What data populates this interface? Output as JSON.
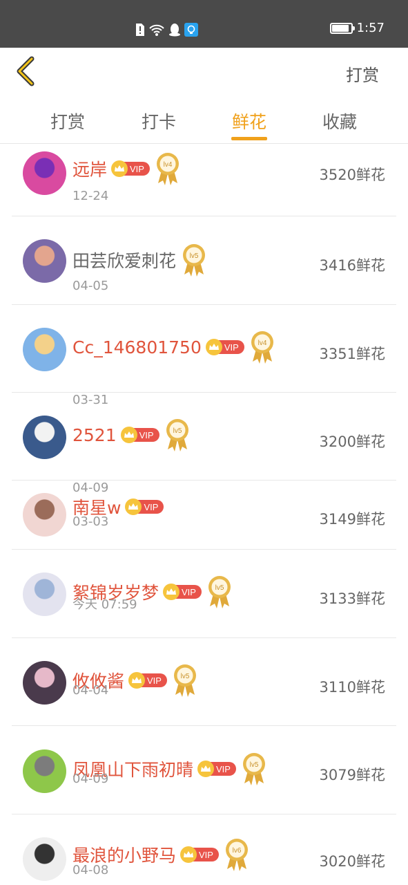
{
  "status_bar": {
    "time": "1:57",
    "battery_level": 0.85
  },
  "header": {
    "back_icon": "chevron-left-icon",
    "action_label": "打赏"
  },
  "tabs": [
    {
      "label": "打赏",
      "active": false
    },
    {
      "label": "打卡",
      "active": false
    },
    {
      "label": "鲜花",
      "active": true
    },
    {
      "label": "收藏",
      "active": false
    }
  ],
  "vip_label": "VIP",
  "rows": [
    {
      "name": "远岸",
      "vip": true,
      "level": "lv4",
      "date": "12-24",
      "count": "3520鲜花"
    },
    {
      "name": "田芸欣爱刺花",
      "vip": false,
      "level": "lv5",
      "date": "04-05",
      "count": "3416鲜花"
    },
    {
      "name": "Cc_146801750",
      "vip": true,
      "level": "lv4",
      "date": "03-31",
      "count": "3351鲜花"
    },
    {
      "name": "2521",
      "vip": true,
      "level": "lv5",
      "date": "04-09",
      "count": "3200鲜花"
    },
    {
      "name": "南星w",
      "vip": true,
      "level": "",
      "date": "03-03",
      "count": "3149鲜花"
    },
    {
      "name": "絮锦岁岁梦",
      "vip": true,
      "level": "lv5",
      "date": "今天 07:59",
      "count": "3133鲜花"
    },
    {
      "name": "攸攸酱",
      "vip": true,
      "level": "lv5",
      "date": "04-04",
      "count": "3110鲜花"
    },
    {
      "name": "凤凰山下雨初晴",
      "vip": true,
      "level": "lv5",
      "date": "04-09",
      "count": "3079鲜花"
    },
    {
      "name": "最浪的小野马",
      "vip": true,
      "level": "lv6",
      "date": "04-08",
      "count": "3020鲜花"
    }
  ],
  "colors": {
    "accent": "#f0a11c",
    "vip_name": "#e0543c",
    "status_bar": "#4a4a4a"
  }
}
